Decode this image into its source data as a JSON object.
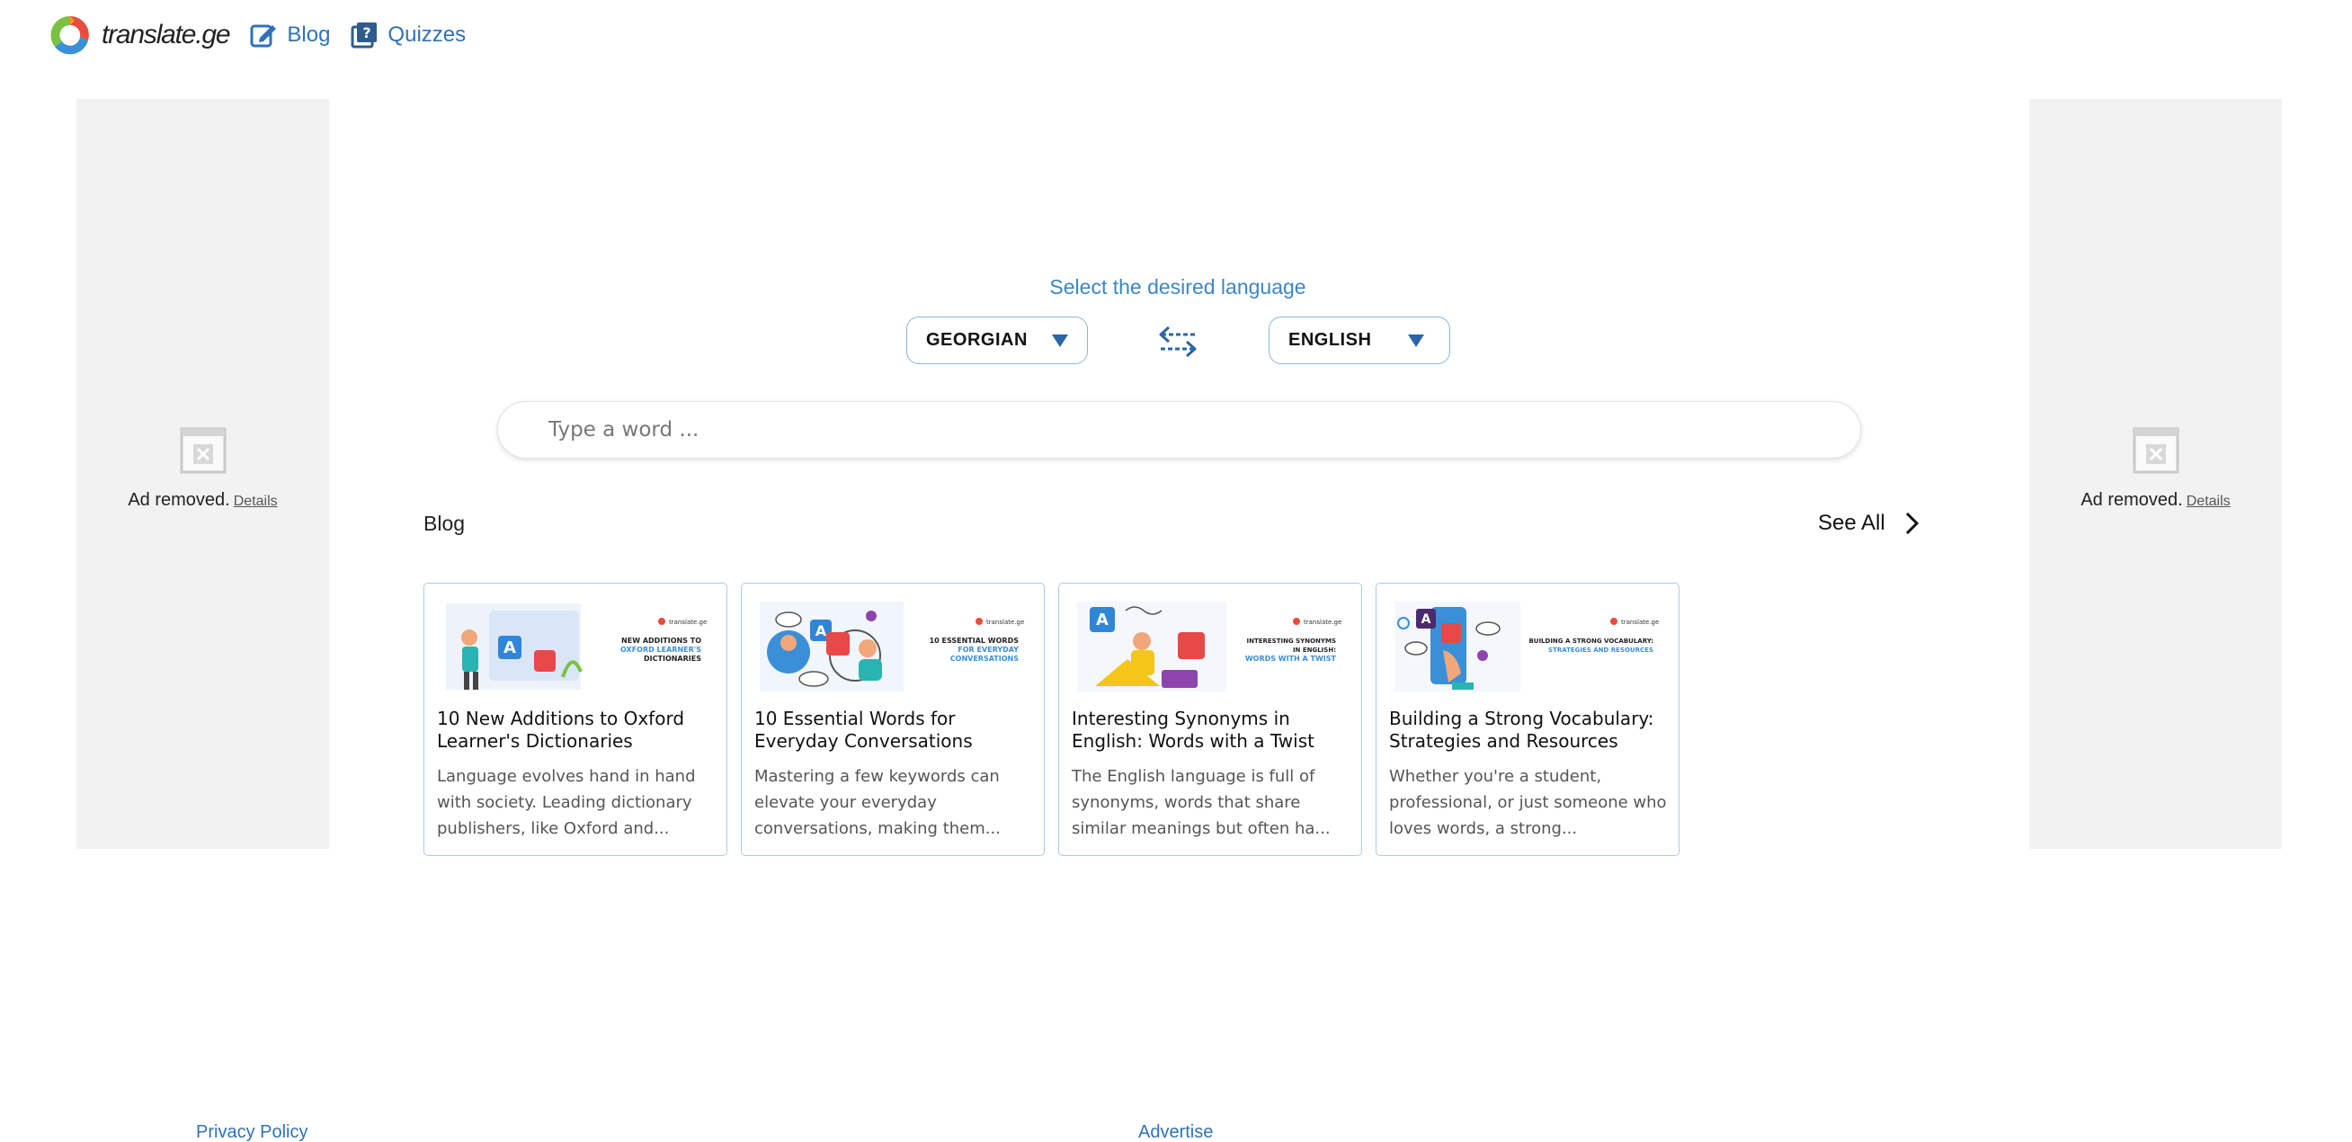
{
  "header": {
    "logo_text": "translate.ge",
    "nav": [
      {
        "label": "Blog",
        "icon": "edit-icon"
      },
      {
        "label": "Quizzes",
        "icon": "quiz-book-icon"
      }
    ]
  },
  "ads": {
    "left": {
      "text": "Ad removed.",
      "link": "Details"
    },
    "right": {
      "text": "Ad removed.",
      "link": "Details"
    }
  },
  "language_selector": {
    "label": "Select the desired language",
    "source": "GEORGIAN",
    "target": "ENGLISH",
    "swap_icon": "swap-arrows-icon"
  },
  "search": {
    "placeholder": "Type a word ...",
    "value": ""
  },
  "blog": {
    "heading": "Blog",
    "see_all": "See All",
    "posts": [
      {
        "title": "10 New Additions to Oxford Learner's Dictionaries",
        "excerpt": "Language evolves hand in hand with society. Leading dictionary publishers, like Oxford and...",
        "image_caption": [
          "NEW ADDITIONS TO",
          "OXFORD LEARNER'S",
          "DICTIONARIES"
        ]
      },
      {
        "title": "10 Essential Words for Everyday Conversations",
        "excerpt": "Mastering a few keywords can elevate your everyday conversations, making them...",
        "image_caption": [
          "10 ESSENTIAL WORDS",
          "FOR EVERYDAY",
          "CONVERSATIONS"
        ]
      },
      {
        "title": "Interesting Synonyms in English: Words with a Twist",
        "excerpt": "The English language is full of synonyms, words that share similar meanings but often ha...",
        "image_caption": [
          "INTERESTING SYNONYMS",
          "IN ENGLISH:",
          "WORDS WITH A TWIST"
        ]
      },
      {
        "title": "Building a Strong Vocabulary: Strategies and Resources",
        "excerpt": "Whether you're a student, professional, or just someone who loves words, a strong...",
        "image_caption": [
          "BUILDING A STRONG VOCABULARY:",
          "STRATEGIES AND RESOURCES",
          ""
        ]
      }
    ],
    "image_brand": "translate.ge"
  },
  "footer": {
    "privacy": "Privacy Policy",
    "advertise": "Advertise"
  },
  "colors": {
    "accent_blue": "#2f72b8",
    "label_blue": "#3d86c7",
    "card_border": "#a9cbe9",
    "ad_background": "#f2f2f2"
  }
}
